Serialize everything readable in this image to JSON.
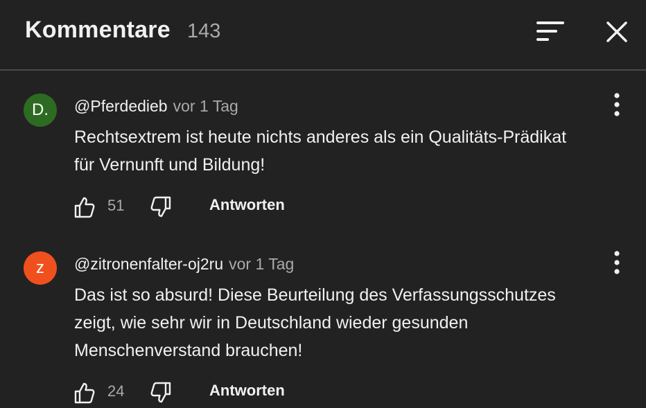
{
  "header": {
    "title": "Kommentare",
    "count": "143",
    "sort_icon": "sort-icon",
    "close_icon": "close-icon"
  },
  "comments": [
    {
      "avatar_letter": "D.",
      "avatar_color": "#2e6b22",
      "author": "@Pferdedieb",
      "time": "vor 1 Tag",
      "text_lines": [
        "Rechtsextrem ist heute nichts anderes als ein Qualitäts-Prädikat",
        "für Vernunft und Bildung!"
      ],
      "likes": "51",
      "reply_label": "Antworten"
    },
    {
      "avatar_letter": "z",
      "avatar_color": "#f0501e",
      "author": "@zitronenfalter-oj2ru",
      "time": "vor 1 Tag",
      "text_lines": [
        "Das ist so absurd! Diese Beurteilung des Verfassungsschutzes",
        "zeigt, wie sehr wir in Deutschland wieder gesunden",
        "Menschenverstand brauchen!"
      ],
      "likes": "24",
      "reply_label": "Antworten"
    }
  ],
  "colors": {
    "background": "#222222",
    "text_primary": "#f1f1f1",
    "text_secondary": "#aaaaaa",
    "divider": "#4a4a4a"
  }
}
